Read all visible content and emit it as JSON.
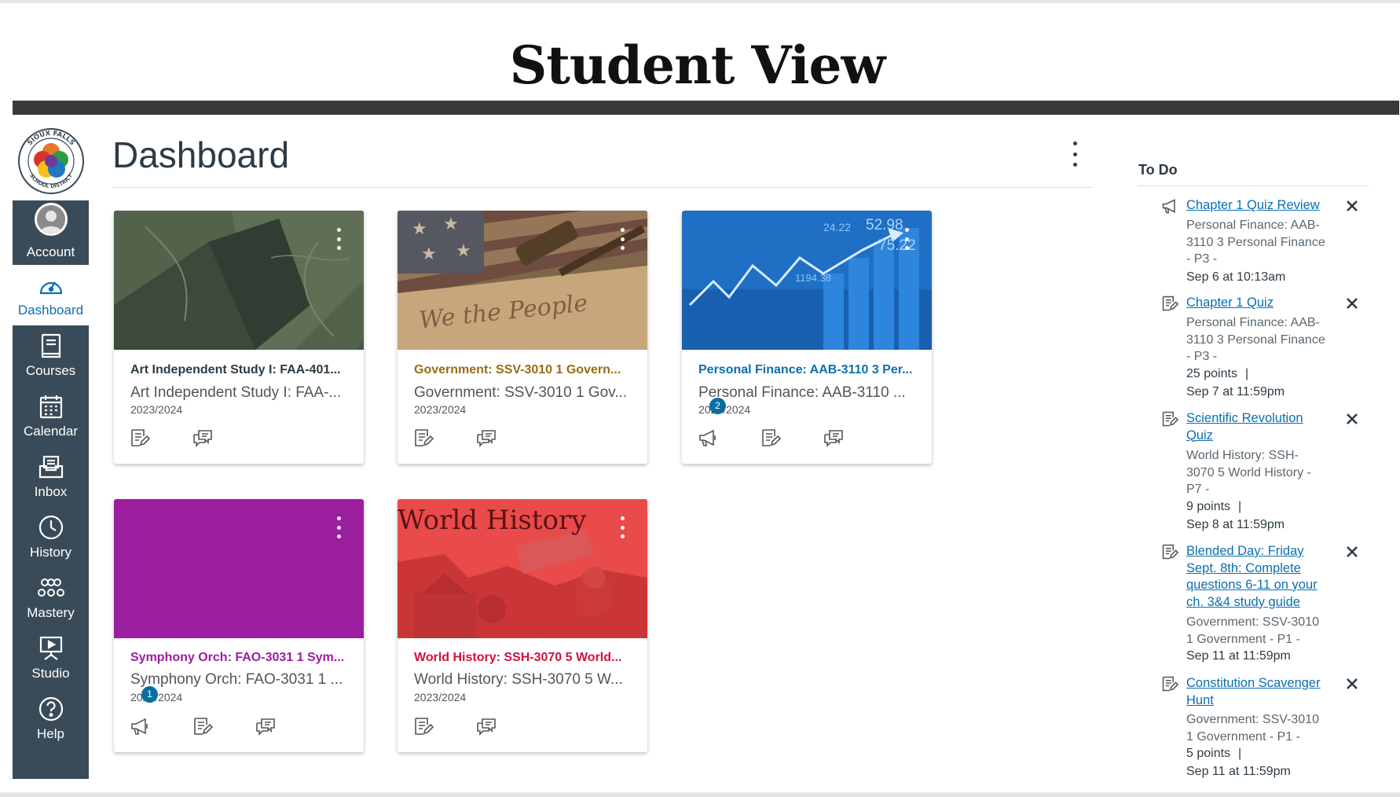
{
  "banner": {
    "title": "Student View"
  },
  "nav": {
    "logo_alt": "Sioux Falls School District",
    "logo_text_top": "SIOUX FALLS",
    "logo_text_bottom": "SCHOOL DISTRICT",
    "items": [
      {
        "label": "Account",
        "icon": "avatar-icon",
        "active": false
      },
      {
        "label": "Dashboard",
        "icon": "dashboard-icon",
        "active": true
      },
      {
        "label": "Courses",
        "icon": "courses-icon",
        "active": false
      },
      {
        "label": "Calendar",
        "icon": "calendar-icon",
        "active": false
      },
      {
        "label": "Inbox",
        "icon": "inbox-icon",
        "active": false
      },
      {
        "label": "History",
        "icon": "clock-icon",
        "active": false
      },
      {
        "label": "Mastery",
        "icon": "mastery-icon",
        "active": false
      },
      {
        "label": "Studio",
        "icon": "studio-icon",
        "active": false
      },
      {
        "label": "Help",
        "icon": "help-icon",
        "active": false
      }
    ]
  },
  "dashboard": {
    "title": "Dashboard",
    "cards": [
      {
        "title": "Art Independent Study I: FAA-401...",
        "subtitle": "Art Independent Study I: FAA-...",
        "term": "2023/2024",
        "color": "#2d3b45",
        "hero": "art",
        "actions": [
          "assignments-icon",
          "discussions-icon"
        ],
        "badge": ""
      },
      {
        "title": "Government: SSV-3010 1 Govern...",
        "subtitle": "Government: SSV-3010 1 Gov...",
        "term": "2023/2024",
        "color": "#9a6b12",
        "hero": "government",
        "actions": [
          "assignments-icon",
          "discussions-icon"
        ],
        "badge": ""
      },
      {
        "title": "Personal Finance: AAB-3110 3 Per...",
        "subtitle": "Personal Finance: AAB-3110 ...",
        "term": "2023/2024",
        "color": "#0b6fb0",
        "hero": "finance",
        "hero_numbers": [
          "52.98",
          "75.22",
          "24.22",
          "1194.38"
        ],
        "actions": [
          "announcements-icon",
          "assignments-icon",
          "discussions-icon"
        ],
        "badge": "2"
      },
      {
        "title": "Symphony Orch: FAO-3031 1 Sym...",
        "subtitle": "Symphony Orch: FAO-3031 1 ...",
        "term": "2023/2024",
        "color": "#9a1e9e",
        "hero": "symphony",
        "actions": [
          "announcements-icon",
          "assignments-icon",
          "discussions-icon"
        ],
        "badge": "1"
      },
      {
        "title": "World History: SSH-3070 5 World...",
        "subtitle": "World History: SSH-3070 5 W...",
        "term": "2023/2024",
        "color": "#d1123f",
        "hero": "history",
        "hero_text": "World History",
        "actions": [
          "assignments-icon",
          "discussions-icon"
        ],
        "badge": ""
      }
    ]
  },
  "todo": {
    "heading": "To Do",
    "items": [
      {
        "icon": "announcement-icon",
        "title_lines": [
          "Chapter 1 Quiz Review"
        ],
        "context_lines": [
          "Personal Finance: AAB-",
          "3110 3 Personal Finance",
          "- P3 -"
        ],
        "points": "",
        "due": "Sep 6 at 10:13am"
      },
      {
        "icon": "assignment-icon",
        "title_lines": [
          "Chapter 1 Quiz"
        ],
        "context_lines": [
          "Personal Finance: AAB-",
          "3110 3 Personal Finance",
          "- P3 -"
        ],
        "points": "25 points",
        "due": "Sep 7 at 11:59pm"
      },
      {
        "icon": "assignment-icon",
        "title_lines": [
          "Scientific Revolution",
          "Quiz"
        ],
        "context_lines": [
          "World History: SSH-",
          "3070 5 World History -",
          "P7 -"
        ],
        "points": "9 points",
        "due": "Sep 8 at 11:59pm"
      },
      {
        "icon": "assignment-icon",
        "title_lines": [
          "Blended Day: Friday",
          "Sept. 8th: Complete",
          "questions 6-11 on your",
          "ch. 3&4 study guide"
        ],
        "context_lines": [
          "Government: SSV-3010",
          "1 Government - P1 -"
        ],
        "points": "",
        "due": "Sep 11 at 11:59pm"
      },
      {
        "icon": "assignment-icon",
        "title_lines": [
          "Constitution Scavenger",
          "Hunt"
        ],
        "context_lines": [
          "Government: SSV-3010",
          "1 Government - P1 -"
        ],
        "points": "5 points",
        "due": "Sep 11 at 11:59pm"
      }
    ]
  }
}
